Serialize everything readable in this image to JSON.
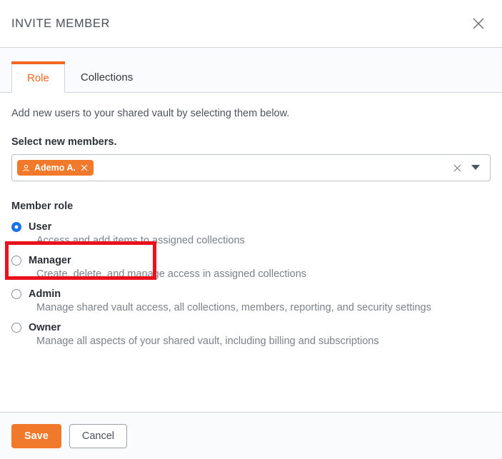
{
  "header": {
    "title": "INVITE MEMBER",
    "close_icon": "close-icon"
  },
  "tabs": [
    {
      "label": "Role",
      "active": true
    },
    {
      "label": "Collections",
      "active": false
    }
  ],
  "body": {
    "intro": "Add new users to your shared vault by selecting them below.",
    "members_field": {
      "label": "Select new members.",
      "chips": [
        {
          "name": "Ademo A.",
          "avatar_icon": "person-icon",
          "remove_icon": "close-icon"
        }
      ],
      "clear_icon": "clear-x-icon",
      "caret_icon": "chevron-down-icon"
    },
    "role_group": {
      "label": "Member role",
      "options": [
        {
          "title": "User",
          "description": "Access and add items to assigned collections",
          "selected": true
        },
        {
          "title": "Manager",
          "description": "Create, delete, and manage access in assigned collections",
          "selected": false
        },
        {
          "title": "Admin",
          "description": "Manage shared vault access, all collections, members, reporting, and security settings",
          "selected": false
        },
        {
          "title": "Owner",
          "description": "Manage all aspects of your shared vault, including billing and subscriptions",
          "selected": false
        }
      ]
    }
  },
  "footer": {
    "save_label": "Save",
    "cancel_label": "Cancel"
  },
  "colors": {
    "accent_orange": "#f1792c",
    "tab_active_text": "#f26522",
    "radio_selected_blue": "#1a73e8",
    "annotation_red": "#e8111c",
    "panel_grey": "#fafbfc",
    "border_grey": "#ccd4dd"
  }
}
